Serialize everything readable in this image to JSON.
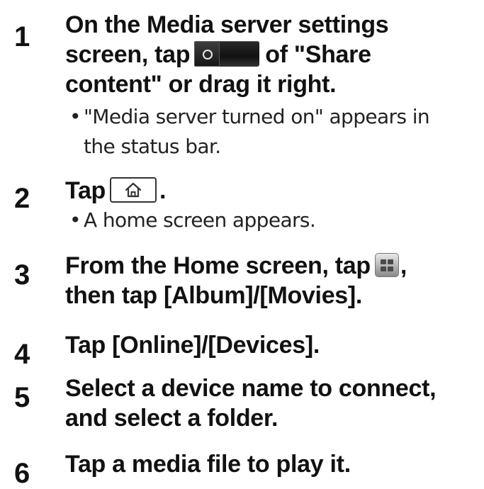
{
  "steps": [
    {
      "number": "1",
      "title_part1": "On the Media server settings screen, tap",
      "title_part2": "of \"Share content\" or drag it right.",
      "note": "\"Media server turned on\" appears in the status bar.",
      "icon": "toggle-switch-icon"
    },
    {
      "number": "2",
      "title_part1": "Tap",
      "title_part2": ".",
      "note": "A home screen appears.",
      "icon": "home-key-icon"
    },
    {
      "number": "3",
      "title_part1": "From the Home screen, tap",
      "title_part2": ", then tap [Album]/[Movies].",
      "icon": "apps-launcher-icon"
    },
    {
      "number": "4",
      "title": "Tap [Online]/[Devices]."
    },
    {
      "number": "5",
      "title": "Select a device name to connect, and select a folder."
    },
    {
      "number": "6",
      "title": "Tap a media file to play it."
    }
  ],
  "bullet": "•"
}
